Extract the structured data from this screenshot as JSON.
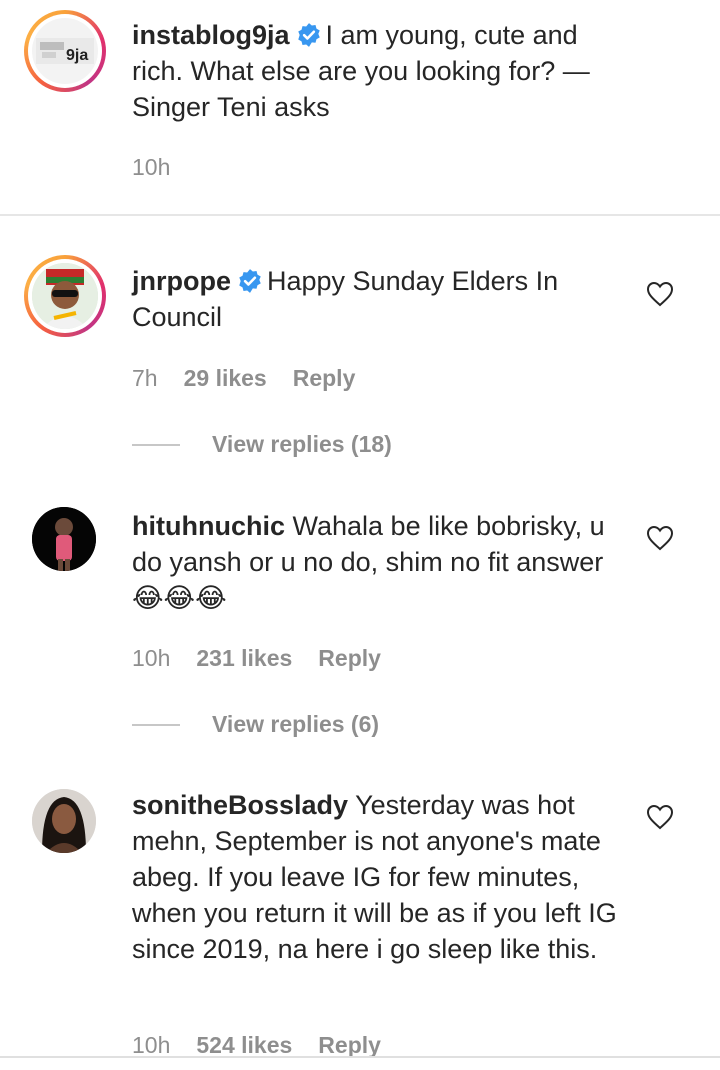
{
  "post": {
    "username": "instablog9ja",
    "caption": "I am young, cute and rich. What else are you looking for? — Singer Teni asks",
    "time": "10h",
    "avatar_text": "9ja"
  },
  "comments": [
    {
      "username": "jnrpope",
      "verified": true,
      "text": "Happy Sunday Elders In Council",
      "time": "7h",
      "likes": "29 likes",
      "reply": "Reply",
      "view_replies": "View replies (18)"
    },
    {
      "username": "hituhnuchic",
      "verified": false,
      "text": "Wahala be like bobrisky, u do yansh or u no do, shim no fit answer",
      "emoji": "😂😂😂",
      "time": "10h",
      "likes": "231 likes",
      "reply": "Reply",
      "view_replies": "View replies (6)"
    },
    {
      "username": "sonitheBosslady",
      "verified": false,
      "text": "Yesterday was hot mehn, September is not anyone's mate abeg. If you leave IG for few minutes, when you return it will be as if you left IG since 2019, na here i go sleep like this.",
      "time": "10h",
      "likes": "524 likes",
      "reply": "Reply"
    }
  ],
  "colors": {
    "text": "#262626",
    "meta": "#8e8e8e",
    "verified": "#3897f0"
  }
}
